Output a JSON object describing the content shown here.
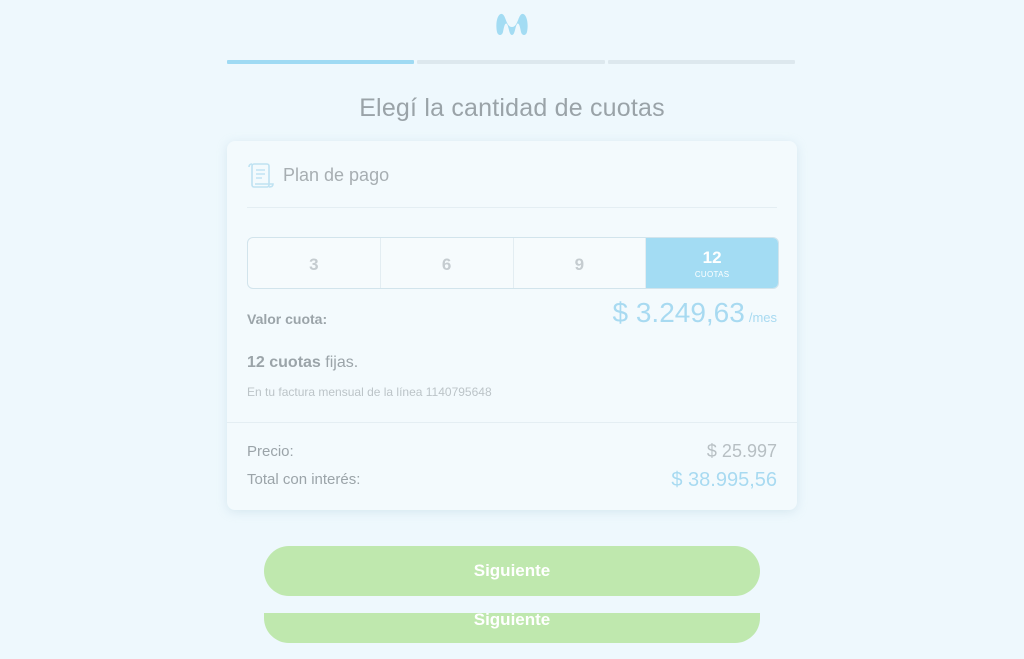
{
  "heading": "Elegí la cantidad de cuotas",
  "progress": {
    "total_steps": 3,
    "current_step": 1
  },
  "card": {
    "icon": "scroll-icon",
    "title": "Plan de pago",
    "options": [
      {
        "value": "3",
        "sub": ""
      },
      {
        "value": "6",
        "sub": ""
      },
      {
        "value": "9",
        "sub": ""
      },
      {
        "value": "12",
        "sub": "CUOTAS"
      }
    ],
    "selected_option": "12",
    "installment_label": "Valor cuota:",
    "installment_amount": "$ 3.249,63",
    "installment_unit": "/mes",
    "fixed_count": "12 cuotas",
    "fixed_suffix": " fijas.",
    "note": "En tu factura mensual de la línea 1140795648",
    "price_label": "Precio:",
    "price_value": "$ 25.997",
    "total_label": "Total con interés:",
    "total_value": "$ 38.995,56"
  },
  "buttons": {
    "next": "Siguiente",
    "next_duplicate": "Siguiente"
  },
  "colors": {
    "accent": "#9fdaf3",
    "button": "#bfe8ae",
    "background": "#eef8fd"
  }
}
